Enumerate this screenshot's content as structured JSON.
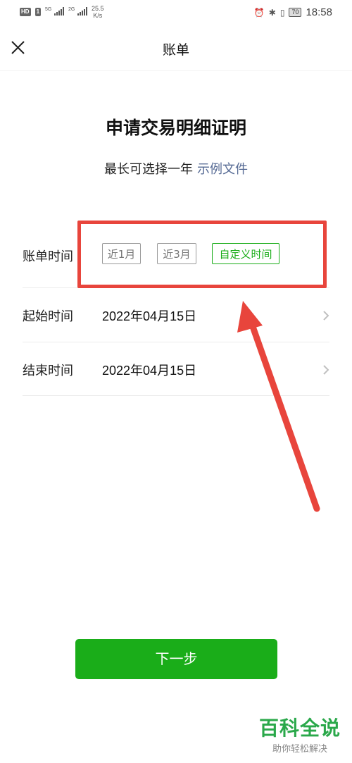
{
  "status_bar": {
    "hd_badge": "HD",
    "sim_badge": "1",
    "net1": "5G",
    "net2": "2G",
    "speed_value": "25.5",
    "speed_unit": "K/s",
    "battery": "70",
    "time": "18:58"
  },
  "nav": {
    "title": "账单"
  },
  "header": {
    "title": "申请交易明细证明",
    "subtitle": "最长可选择一年",
    "example_link": "示例文件"
  },
  "bill_time": {
    "label": "账单时间",
    "options": [
      "近1月",
      "近3月",
      "自定义时间"
    ],
    "selected": "自定义时间"
  },
  "start_time": {
    "label": "起始时间",
    "value": "2022年04月15日"
  },
  "end_time": {
    "label": "结束时间",
    "value": "2022年04月15日"
  },
  "next_button": "下一步",
  "watermark": {
    "title": "百科全说",
    "subtitle": "助你轻松解决"
  },
  "colors": {
    "accent_green": "#1aad19",
    "link_blue": "#576b95",
    "annotation_red": "#e8453c"
  }
}
